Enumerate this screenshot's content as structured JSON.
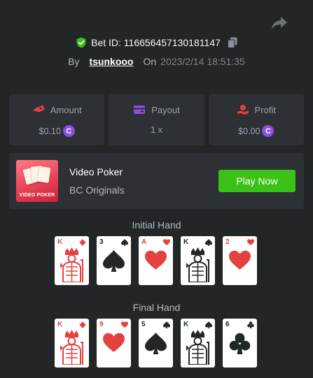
{
  "header": {
    "bet_id": "Bet ID: 116656457130181147",
    "by_label": "By",
    "username": "tsunkooo",
    "on_label": "On",
    "date": "2023/2/14 18:51:35"
  },
  "stats": {
    "amount_label": "Amount",
    "amount_value": "$0.10",
    "payout_label": "Payout",
    "payout_value": "1 x",
    "profit_label": "Profit",
    "profit_value": "$0.00",
    "coin_symbol": "C"
  },
  "game": {
    "thumb_label": "VIDEO POKER",
    "name": "Video Poker",
    "provider": "BC Originals",
    "play_label": "Play Now"
  },
  "initial_hand": {
    "title": "Initial Hand",
    "cards": [
      {
        "rank": "K",
        "suit": "diamond",
        "color": "red"
      },
      {
        "rank": "3",
        "suit": "spade",
        "color": "black"
      },
      {
        "rank": "A",
        "suit": "heart",
        "color": "red"
      },
      {
        "rank": "K",
        "suit": "spade",
        "color": "black"
      },
      {
        "rank": "2",
        "suit": "heart",
        "color": "red"
      }
    ]
  },
  "final_hand": {
    "title": "Final Hand",
    "cards": [
      {
        "rank": "K",
        "suit": "diamond",
        "color": "red"
      },
      {
        "rank": "9",
        "suit": "heart",
        "color": "red"
      },
      {
        "rank": "5",
        "suit": "spade",
        "color": "black"
      },
      {
        "rank": "K",
        "suit": "spade",
        "color": "black"
      },
      {
        "rank": "6",
        "suit": "club",
        "color": "black"
      }
    ]
  },
  "colors": {
    "background": "#232626",
    "panel": "#2d3035",
    "play_button": "#3bc117",
    "coin": "#8b4fe0",
    "red_suit": "#e3423e"
  }
}
